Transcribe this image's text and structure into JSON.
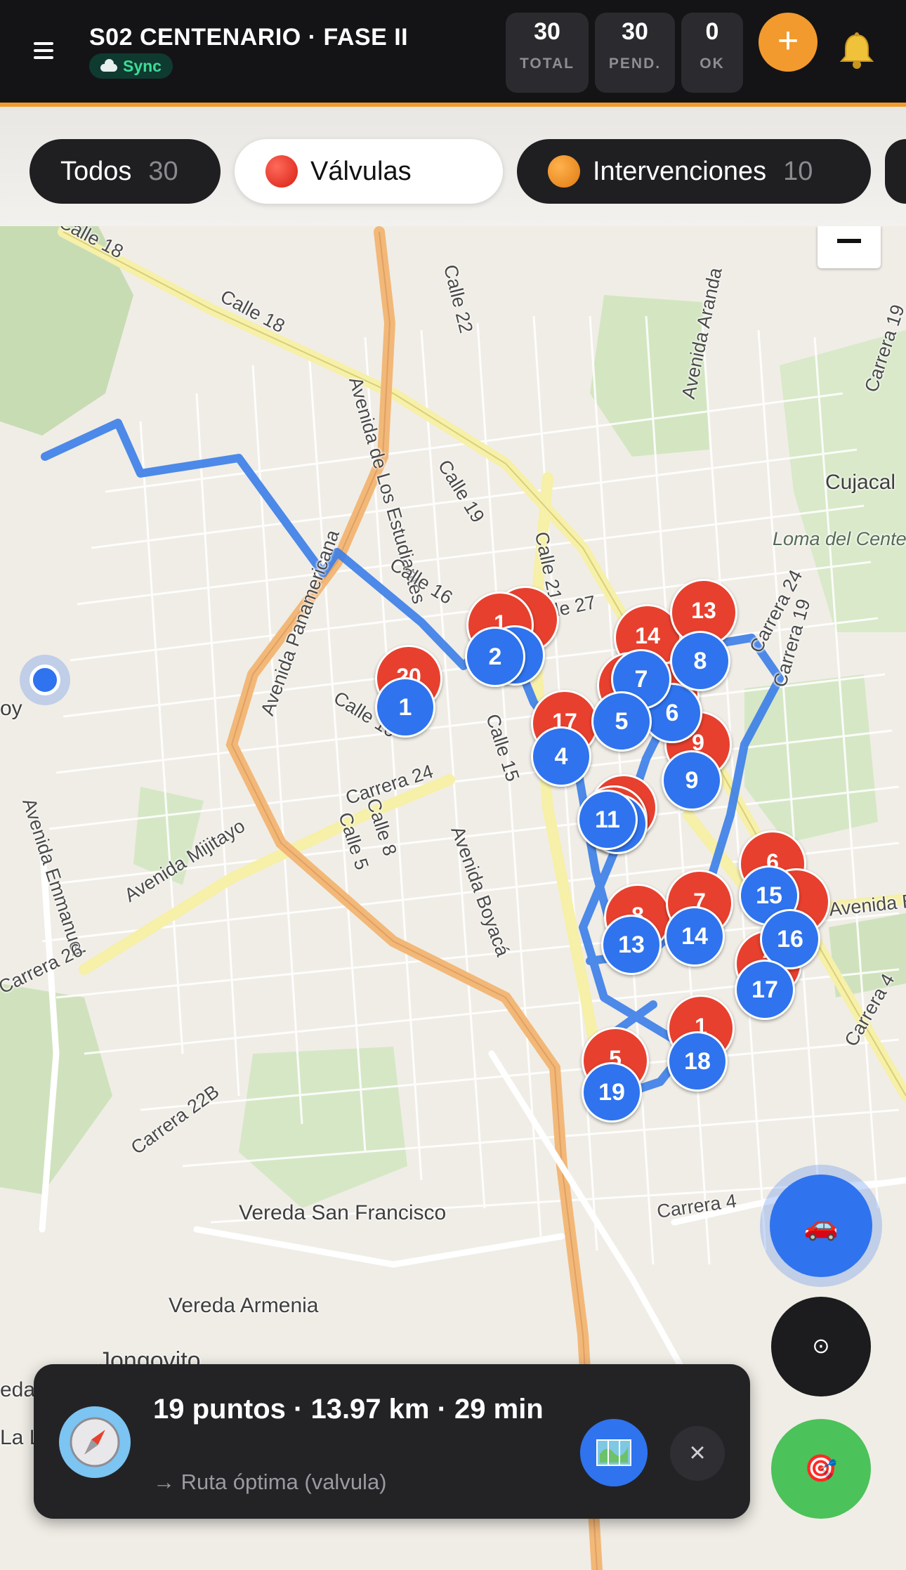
{
  "header": {
    "title": "S02 CENTENARIO · FASE II",
    "sync_label": "Sync",
    "stats": [
      {
        "value": "30",
        "label": "TOTAL"
      },
      {
        "value": "30",
        "label": "PEND."
      },
      {
        "value": "0",
        "label": "OK"
      }
    ],
    "add_label": "+",
    "icons": {
      "menu": "menu-icon",
      "cloud": "cloud-icon",
      "bell": "bell-icon"
    }
  },
  "filters": [
    {
      "label": "Todos",
      "count": "30",
      "active": false
    },
    {
      "label": "Válvulas",
      "count": "",
      "active": true,
      "dot_color": "#e8402e"
    },
    {
      "label": "Intervenciones",
      "count": "10",
      "active": false,
      "dot_color": "#f29a2e"
    }
  ],
  "map": {
    "street_labels": [
      "Calle 18",
      "Calle 18",
      "Avenida de Los Estudiantes",
      "Calle 22",
      "Calle 19",
      "Calle 21",
      "Avenida Aranda",
      "Carrera 19",
      "Carrera 24",
      "Carrera 19",
      "Calle 16",
      "Avenida Panamericana",
      "Calle 15",
      "Calle 17",
      "Calle 10",
      "Carrera 24",
      "Calle 5",
      "Calle 8",
      "Avenida Boyacá",
      "Avenida Mijitayo",
      "Avenida Emmanuel",
      "Carrera 26",
      "Carrera 22B",
      "Carrera 4",
      "Avenida Bolívar",
      "Carrera 4",
      "Calle 27"
    ],
    "place_labels": [
      "Cujacal",
      "Loma del Centenario",
      "Vereda San Francisco",
      "Vereda Armenia",
      "Jongovito",
      "oy",
      "eda",
      "La L"
    ],
    "red_markers": [
      "20",
      "1",
      "",
      "14",
      "13",
      "17",
      "1",
      "5",
      "9",
      "8",
      "7",
      "6",
      "2",
      "1",
      "5"
    ],
    "blue_markers": [
      "1",
      "2",
      "3",
      "4",
      "5",
      "6",
      "7",
      "8",
      "9",
      "11",
      "13",
      "14",
      "15",
      "16",
      "17",
      "18",
      "19"
    ],
    "zoom_out_label": "−"
  },
  "fabs": {
    "car_icon": "🚗",
    "locate_icon": "⊙",
    "target_icon": "🎯"
  },
  "route_panel": {
    "title": "19 puntos · 13.97 km · 29 min",
    "subtitle": "→ Ruta óptima (valvula)",
    "close_label": "×",
    "icons": {
      "compass": "compass-icon",
      "map": "map-icon"
    }
  }
}
